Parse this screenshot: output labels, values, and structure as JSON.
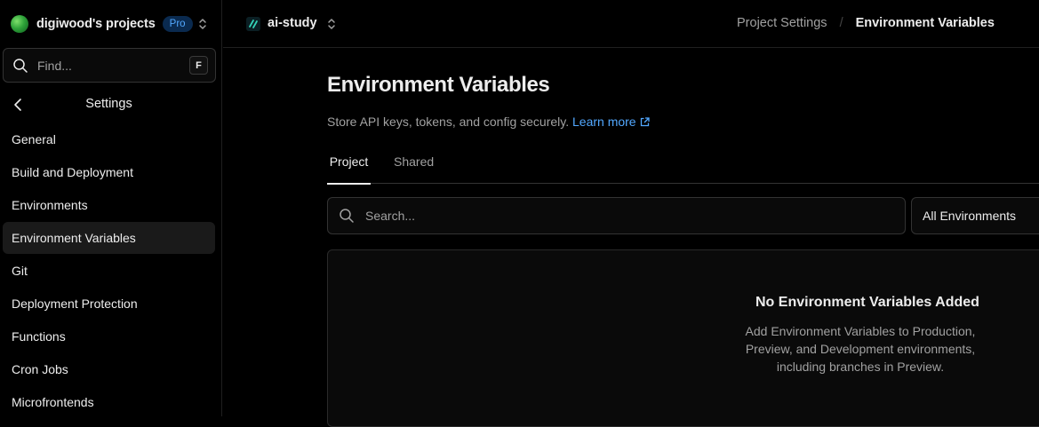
{
  "team": {
    "name": "digiwood's projects",
    "plan_badge": "Pro"
  },
  "sidebar": {
    "search_placeholder": "Find...",
    "search_shortcut": "F",
    "section_title": "Settings",
    "items": [
      {
        "label": "General",
        "active": false
      },
      {
        "label": "Build and Deployment",
        "active": false
      },
      {
        "label": "Environments",
        "active": false
      },
      {
        "label": "Environment Variables",
        "active": true
      },
      {
        "label": "Git",
        "active": false
      },
      {
        "label": "Deployment Protection",
        "active": false
      },
      {
        "label": "Functions",
        "active": false
      },
      {
        "label": "Cron Jobs",
        "active": false
      },
      {
        "label": "Microfrontends",
        "active": false
      }
    ]
  },
  "topbar": {
    "project_name": "ai-study",
    "breadcrumb": {
      "parent": "Project Settings",
      "separator": "/",
      "current": "Environment Variables"
    }
  },
  "main": {
    "title": "Environment Variables",
    "description": "Store API keys, tokens, and config securely.",
    "learn_more": "Learn more",
    "tabs": [
      {
        "label": "Project",
        "active": true
      },
      {
        "label": "Shared",
        "active": false
      }
    ],
    "search_placeholder": "Search...",
    "environment_filter": "All Environments",
    "empty_state": {
      "title": "No Environment Variables Added",
      "description": "Add Environment Variables to Production, Preview, and Development environments, including branches in Preview."
    }
  },
  "colors": {
    "background": "#000000",
    "accent_link": "#52a8ff",
    "plan_badge_bg": "#0a2a4f",
    "active_nav_bg": "#1a1a1a"
  }
}
